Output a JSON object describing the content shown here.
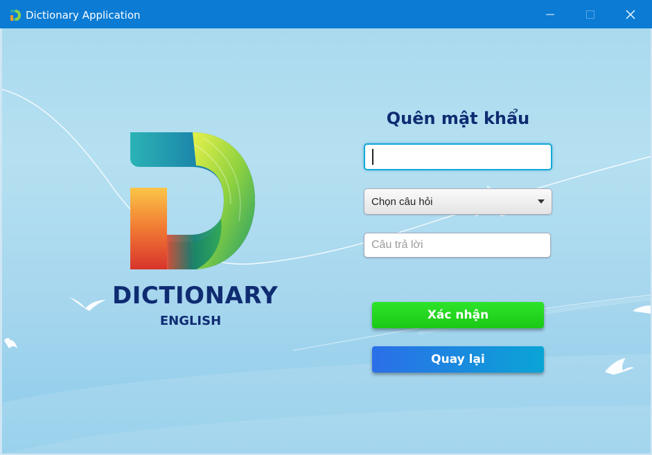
{
  "window": {
    "title": "Dictionary Application",
    "controls": [
      "minimize",
      "maximize",
      "close"
    ]
  },
  "brand": {
    "logo_letter": "D",
    "name": "DICTIONARY",
    "subtitle": "ENGLISH"
  },
  "form": {
    "title": "Quên mật khẩu",
    "username": {
      "value": "",
      "placeholder": ""
    },
    "question_select": {
      "selected": "Chọn câu hỏi"
    },
    "answer": {
      "value": "",
      "placeholder": "Câu trả lời"
    },
    "confirm_label": "Xác nhận",
    "back_label": "Quay lại"
  },
  "colors": {
    "titlebar": "#0b7bd4",
    "brand_text": "#0f2c72",
    "confirm_button": "#22d61f",
    "back_button": "#2b6fe8",
    "input_focus_border": "#12a9d6"
  },
  "icons": [
    "dictionary-app-icon",
    "minimize-icon",
    "maximize-icon",
    "close-icon",
    "dropdown-arrow-icon",
    "dictionary-logo"
  ]
}
